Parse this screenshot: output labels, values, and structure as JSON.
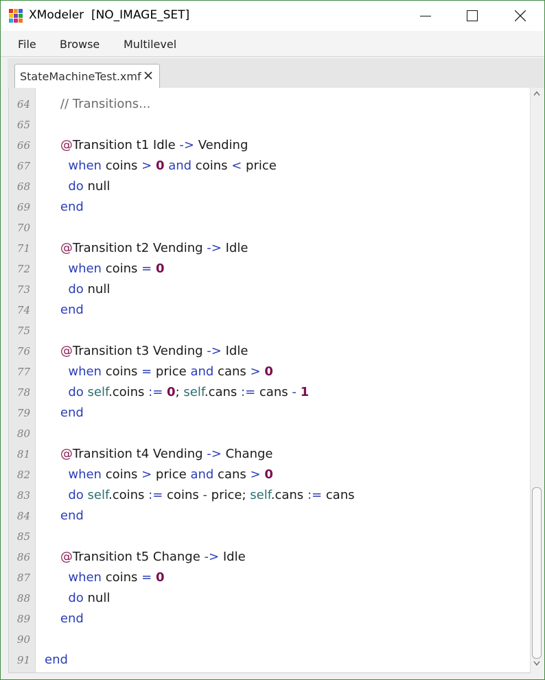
{
  "window": {
    "title": "XModeler  [NO_IMAGE_SET]"
  },
  "menu": {
    "items": [
      "File",
      "Browse",
      "Multilevel"
    ]
  },
  "tabs": [
    {
      "label": "StateMachineTest.xmf"
    }
  ],
  "colors": {
    "annotation": "#8b1e57",
    "keyword": "#2b3db8",
    "number": "#7a0d4f",
    "self": "#2b6e6e",
    "comment": "#6b6b6b",
    "frame_border": "#3e8a3e"
  },
  "editor": {
    "lines": [
      {
        "n": "64",
        "tokens": [
          {
            "t": "    "
          },
          {
            "t": "// Transitions...",
            "c": "comment"
          }
        ]
      },
      {
        "n": "65",
        "tokens": []
      },
      {
        "n": "66",
        "tokens": [
          {
            "t": "    "
          },
          {
            "t": "@",
            "c": "ann"
          },
          {
            "t": "Transition t1 Idle "
          },
          {
            "t": "->",
            "c": "kw"
          },
          {
            "t": " Vending"
          }
        ]
      },
      {
        "n": "67",
        "tokens": [
          {
            "t": "      "
          },
          {
            "t": "when",
            "c": "kw"
          },
          {
            "t": " coins "
          },
          {
            "t": ">",
            "c": "kw"
          },
          {
            "t": " "
          },
          {
            "t": "0",
            "c": "num"
          },
          {
            "t": " "
          },
          {
            "t": "and",
            "c": "kw"
          },
          {
            "t": " coins "
          },
          {
            "t": "<",
            "c": "kw"
          },
          {
            "t": " price"
          }
        ]
      },
      {
        "n": "68",
        "tokens": [
          {
            "t": "      "
          },
          {
            "t": "do",
            "c": "kw"
          },
          {
            "t": " null"
          }
        ]
      },
      {
        "n": "69",
        "tokens": [
          {
            "t": "    "
          },
          {
            "t": "end",
            "c": "kw"
          }
        ]
      },
      {
        "n": "70",
        "tokens": []
      },
      {
        "n": "71",
        "tokens": [
          {
            "t": "    "
          },
          {
            "t": "@",
            "c": "ann"
          },
          {
            "t": "Transition t2 Vending "
          },
          {
            "t": "->",
            "c": "kw"
          },
          {
            "t": " Idle"
          }
        ]
      },
      {
        "n": "72",
        "tokens": [
          {
            "t": "      "
          },
          {
            "t": "when",
            "c": "kw"
          },
          {
            "t": " coins "
          },
          {
            "t": "=",
            "c": "kw"
          },
          {
            "t": " "
          },
          {
            "t": "0",
            "c": "num"
          }
        ]
      },
      {
        "n": "73",
        "tokens": [
          {
            "t": "      "
          },
          {
            "t": "do",
            "c": "kw"
          },
          {
            "t": " null"
          }
        ]
      },
      {
        "n": "74",
        "tokens": [
          {
            "t": "    "
          },
          {
            "t": "end",
            "c": "kw"
          }
        ]
      },
      {
        "n": "75",
        "tokens": []
      },
      {
        "n": "76",
        "tokens": [
          {
            "t": "    "
          },
          {
            "t": "@",
            "c": "ann"
          },
          {
            "t": "Transition t3 Vending "
          },
          {
            "t": "->",
            "c": "kw"
          },
          {
            "t": " Idle"
          }
        ]
      },
      {
        "n": "77",
        "tokens": [
          {
            "t": "      "
          },
          {
            "t": "when",
            "c": "kw"
          },
          {
            "t": " coins "
          },
          {
            "t": "=",
            "c": "kw"
          },
          {
            "t": " price "
          },
          {
            "t": "and",
            "c": "kw"
          },
          {
            "t": " cans "
          },
          {
            "t": ">",
            "c": "kw"
          },
          {
            "t": " "
          },
          {
            "t": "0",
            "c": "num"
          }
        ]
      },
      {
        "n": "78",
        "tokens": [
          {
            "t": "      "
          },
          {
            "t": "do",
            "c": "kw"
          },
          {
            "t": " "
          },
          {
            "t": "self",
            "c": "self"
          },
          {
            "t": ".coins "
          },
          {
            "t": ":=",
            "c": "kw"
          },
          {
            "t": " "
          },
          {
            "t": "0",
            "c": "num"
          },
          {
            "t": "; "
          },
          {
            "t": "self",
            "c": "self"
          },
          {
            "t": ".cans "
          },
          {
            "t": ":=",
            "c": "kw"
          },
          {
            "t": " cans "
          },
          {
            "t": "-",
            "c": "kw"
          },
          {
            "t": " "
          },
          {
            "t": "1",
            "c": "num"
          }
        ]
      },
      {
        "n": "79",
        "tokens": [
          {
            "t": "    "
          },
          {
            "t": "end",
            "c": "kw"
          }
        ]
      },
      {
        "n": "80",
        "tokens": []
      },
      {
        "n": "81",
        "tokens": [
          {
            "t": "    "
          },
          {
            "t": "@",
            "c": "ann"
          },
          {
            "t": "Transition t4 Vending "
          },
          {
            "t": "->",
            "c": "kw"
          },
          {
            "t": " Change"
          }
        ]
      },
      {
        "n": "82",
        "tokens": [
          {
            "t": "      "
          },
          {
            "t": "when",
            "c": "kw"
          },
          {
            "t": " coins "
          },
          {
            "t": ">",
            "c": "kw"
          },
          {
            "t": " price "
          },
          {
            "t": "and",
            "c": "kw"
          },
          {
            "t": " cans "
          },
          {
            "t": ">",
            "c": "kw"
          },
          {
            "t": " "
          },
          {
            "t": "0",
            "c": "num"
          }
        ]
      },
      {
        "n": "83",
        "tokens": [
          {
            "t": "      "
          },
          {
            "t": "do",
            "c": "kw"
          },
          {
            "t": " "
          },
          {
            "t": "self",
            "c": "self"
          },
          {
            "t": ".coins "
          },
          {
            "t": ":=",
            "c": "kw"
          },
          {
            "t": " coins "
          },
          {
            "t": "-",
            "c": "kw"
          },
          {
            "t": " price; "
          },
          {
            "t": "self",
            "c": "self"
          },
          {
            "t": ".cans "
          },
          {
            "t": ":=",
            "c": "kw"
          },
          {
            "t": " cans"
          }
        ]
      },
      {
        "n": "84",
        "tokens": [
          {
            "t": "    "
          },
          {
            "t": "end",
            "c": "kw"
          }
        ]
      },
      {
        "n": "85",
        "tokens": []
      },
      {
        "n": "86",
        "tokens": [
          {
            "t": "    "
          },
          {
            "t": "@",
            "c": "ann"
          },
          {
            "t": "Transition t5 Change "
          },
          {
            "t": "->",
            "c": "kw"
          },
          {
            "t": " Idle"
          }
        ]
      },
      {
        "n": "87",
        "tokens": [
          {
            "t": "      "
          },
          {
            "t": "when",
            "c": "kw"
          },
          {
            "t": " coins "
          },
          {
            "t": "=",
            "c": "kw"
          },
          {
            "t": " "
          },
          {
            "t": "0",
            "c": "num"
          }
        ]
      },
      {
        "n": "88",
        "tokens": [
          {
            "t": "      "
          },
          {
            "t": "do",
            "c": "kw"
          },
          {
            "t": " null"
          }
        ]
      },
      {
        "n": "89",
        "tokens": [
          {
            "t": "    "
          },
          {
            "t": "end",
            "c": "kw"
          }
        ]
      },
      {
        "n": "90",
        "tokens": []
      },
      {
        "n": "91",
        "tokens": [
          {
            "t": "end",
            "c": "kw"
          }
        ]
      }
    ]
  }
}
